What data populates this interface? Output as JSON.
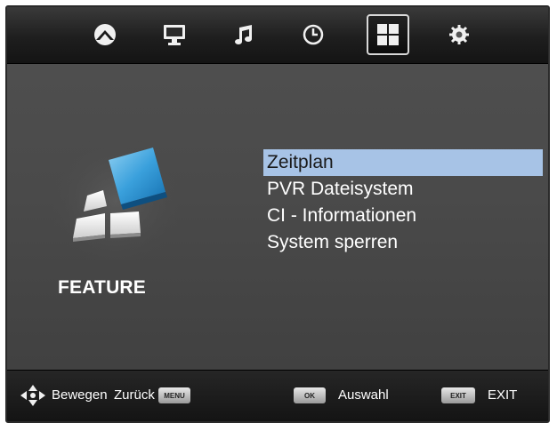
{
  "tabs": [
    {
      "icon": "satellite-icon",
      "active": false
    },
    {
      "icon": "monitor-icon",
      "active": false
    },
    {
      "icon": "music-note-icon",
      "active": false
    },
    {
      "icon": "clock-icon",
      "active": false
    },
    {
      "icon": "feature-grid-icon",
      "active": true
    },
    {
      "icon": "settings-gear-icon",
      "active": false
    }
  ],
  "section": {
    "title": "FEATURE"
  },
  "menu": {
    "items": [
      {
        "label": "Zeitplan",
        "selected": true
      },
      {
        "label": "PVR Dateisystem",
        "selected": false
      },
      {
        "label": "CI - Informationen",
        "selected": false
      },
      {
        "label": "System sperren",
        "selected": false
      }
    ]
  },
  "footer": {
    "move_label": "Bewegen",
    "back_label": "Zurück",
    "menu_key": "MENU",
    "ok_key": "OK",
    "select_label": "Auswahl",
    "exit_key": "EXIT",
    "exit_label": "EXIT"
  },
  "colors": {
    "selection": "#a7c3e6",
    "background": "#4a4a4a",
    "bar": "#141414"
  }
}
